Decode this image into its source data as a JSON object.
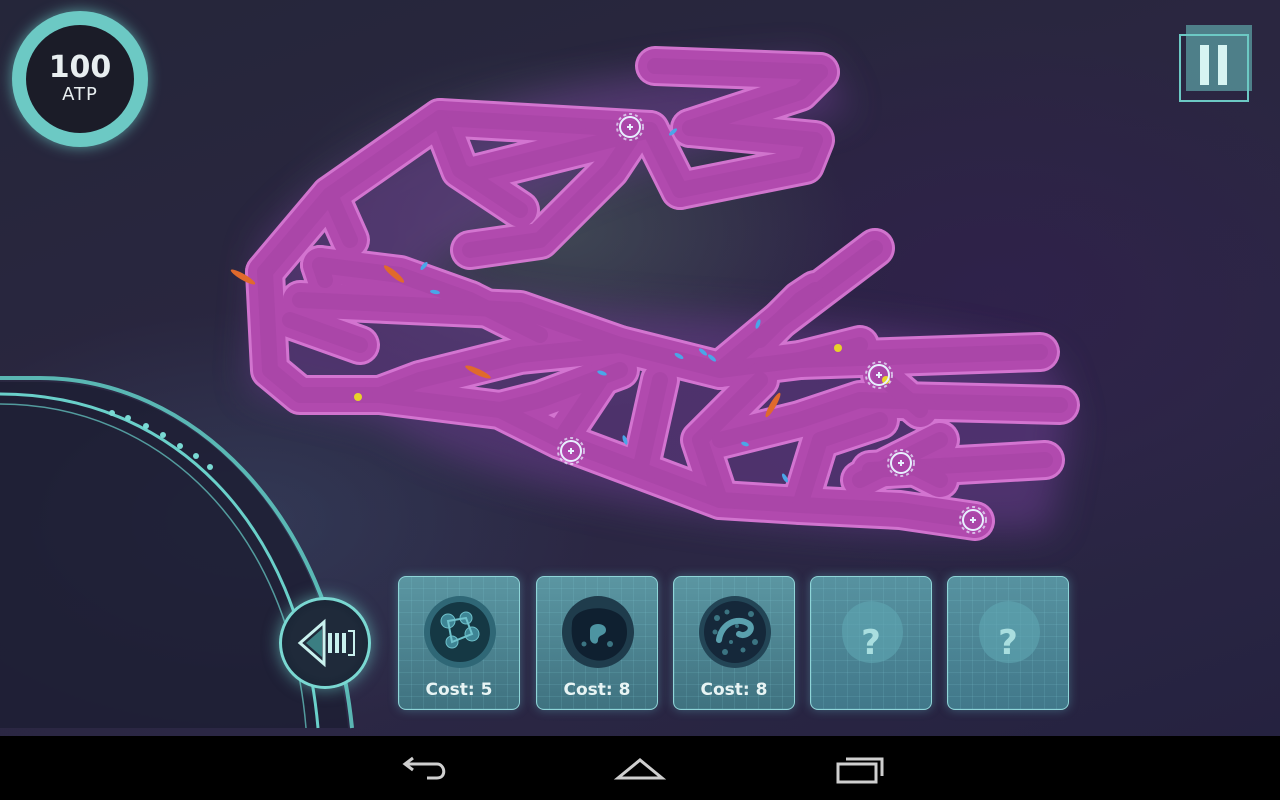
{
  "hud": {
    "atp_value": "100",
    "atp_unit": "ATP"
  },
  "units": [
    {
      "cost": "Cost: 5",
      "icon": "lymphocyte-cell-icon",
      "locked": false
    },
    {
      "cost": "Cost: 8",
      "icon": "macrophage-cell-icon",
      "locked": false
    },
    {
      "cost": "Cost: 8",
      "icon": "neutrophil-cell-icon",
      "locked": false
    },
    {
      "label": "?",
      "icon": "locked-cell-icon",
      "locked": true
    },
    {
      "label": "?",
      "icon": "locked-cell-icon",
      "locked": true
    }
  ],
  "colors": {
    "vessel": "#b64bb4",
    "vessel_edge": "#e070d8",
    "accent": "#6cc9c4",
    "card": "#4a8592"
  },
  "navbar": {
    "buttons": [
      "back-icon",
      "home-icon",
      "recents-icon"
    ]
  }
}
